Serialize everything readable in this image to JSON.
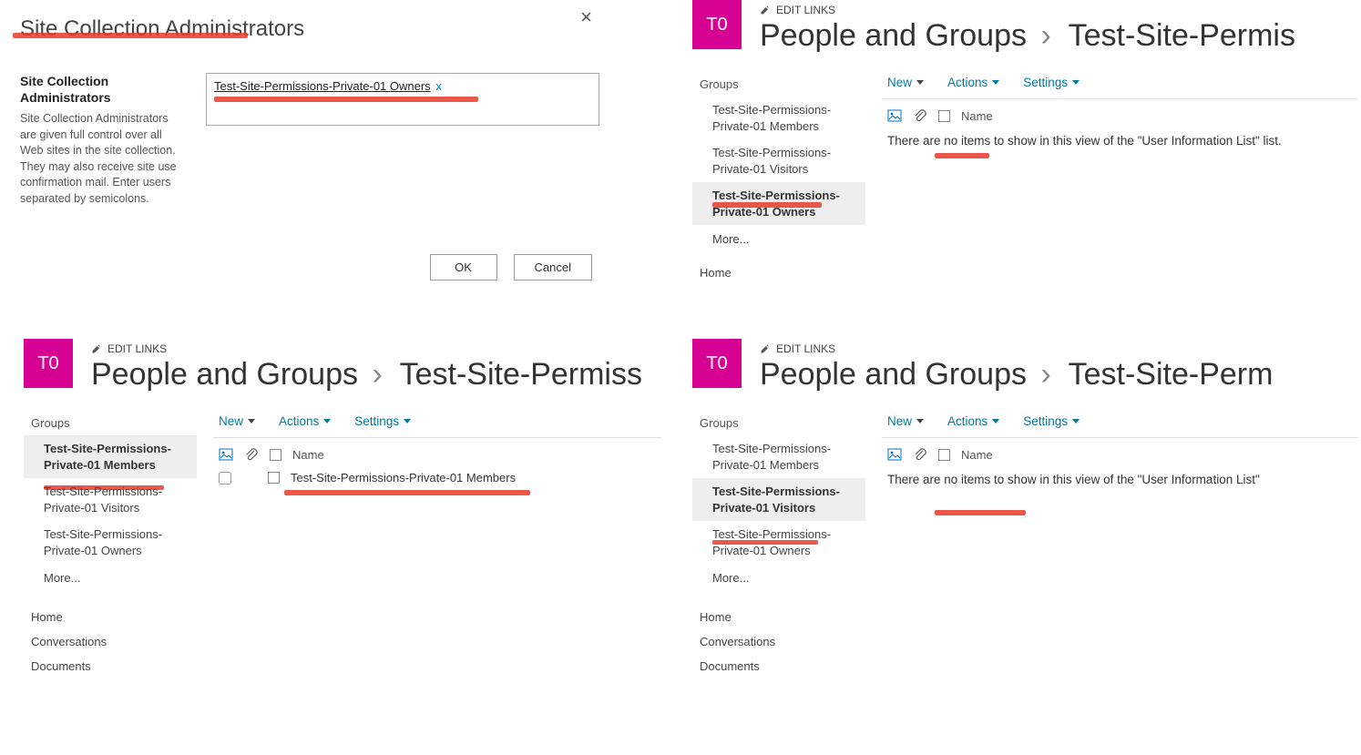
{
  "dialog": {
    "title": "Site Collection Administrators",
    "close_glyph": "×",
    "section_heading": "Site Collection Administrators",
    "help_text": "Site Collection Administrators are given full control over all Web sites in the site collection. They may also receive site use confirmation mail. Enter users separated by semicolons.",
    "chip_text": "Test-Site-Permissions-Private-01 Owners",
    "chip_remove": "x",
    "ok_label": "OK",
    "cancel_label": "Cancel"
  },
  "common": {
    "logo_text": "T0",
    "edit_links": "EDIT LINKS",
    "crumb_root": "People and Groups",
    "crumb_child": "Test-Site-Permis",
    "crumb_child_alt": "Test-Site-Perm",
    "crumb_child_alt2": "Test-Site-Permiss",
    "groups_label": "Groups",
    "grp_members": "Test-Site-Permissions-Private-01 Members",
    "grp_visitors": "Test-Site-Permissions-Private-01 Visitors",
    "grp_owners": "Test-Site-Permissions-Private-01 Owners",
    "grp_members_wr": "Test-Site-Permissions-Private-01 Members",
    "grp_visitors_wr": "Test-Site-Permissions-Private-01 Visitors",
    "grp_owners_wr": "Test-Site-Permissions-Private-01 Owners",
    "more": "More...",
    "nav_home": "Home",
    "nav_conversations": "Conversations",
    "nav_documents": "Documents",
    "tb_new": "New",
    "tb_actions": "Actions",
    "tb_settings": "Settings",
    "col_name": "Name",
    "empty_msg": "There are no items to show in this view of the \"User Information List\" list.",
    "empty_msg_trunc": "There are no items to show in this view of the \"User Information List\"",
    "row_item": "Test-Site-Permissions-Private-01 Members"
  }
}
